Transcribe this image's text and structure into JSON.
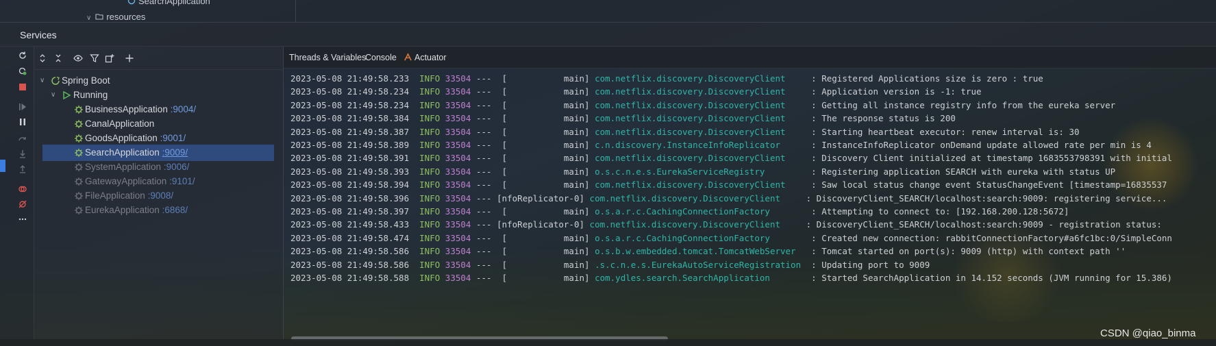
{
  "top": {
    "line1": "SearchApplication",
    "line2": "resources"
  },
  "services": {
    "title": "Services"
  },
  "tree": {
    "root": "Spring Boot",
    "group": "Running",
    "apps": [
      {
        "name": "BusinessApplication",
        "port": ":9004/",
        "running": true
      },
      {
        "name": "CanalApplication",
        "port": "",
        "running": true
      },
      {
        "name": "GoodsApplication",
        "port": ":9001/",
        "running": true
      },
      {
        "name": "SearchApplication",
        "port": ":9009/",
        "running": true,
        "selected": true
      },
      {
        "name": "SystemApplication",
        "port": ":9006/",
        "running": false
      },
      {
        "name": "GatewayApplication",
        "port": ":9101/",
        "running": false
      },
      {
        "name": "FileApplication",
        "port": ":9008/",
        "running": false
      },
      {
        "name": "EurekaApplication",
        "port": ":6868/",
        "running": false
      }
    ]
  },
  "console": {
    "tabs": [
      "Threads & Variables",
      "Console",
      "Actuator"
    ],
    "rows": [
      {
        "ts": "2023-05-08 21:49:58.233",
        "lvl": "INFO",
        "pid": "33504",
        "thread": "---  [           main]",
        "logger": "com.netflix.discovery.DiscoveryClient    ",
        "msg": " : Registered Applications size is zero : true"
      },
      {
        "ts": "2023-05-08 21:49:58.234",
        "lvl": "INFO",
        "pid": "33504",
        "thread": "---  [           main]",
        "logger": "com.netflix.discovery.DiscoveryClient    ",
        "msg": " : Application version is -1: true"
      },
      {
        "ts": "2023-05-08 21:49:58.234",
        "lvl": "INFO",
        "pid": "33504",
        "thread": "---  [           main]",
        "logger": "com.netflix.discovery.DiscoveryClient    ",
        "msg": " : Getting all instance registry info from the eureka server"
      },
      {
        "ts": "2023-05-08 21:49:58.384",
        "lvl": "INFO",
        "pid": "33504",
        "thread": "---  [           main]",
        "logger": "com.netflix.discovery.DiscoveryClient    ",
        "msg": " : The response status is 200"
      },
      {
        "ts": "2023-05-08 21:49:58.387",
        "lvl": "INFO",
        "pid": "33504",
        "thread": "---  [           main]",
        "logger": "com.netflix.discovery.DiscoveryClient    ",
        "msg": " : Starting heartbeat executor: renew interval is: 30"
      },
      {
        "ts": "2023-05-08 21:49:58.389",
        "lvl": "INFO",
        "pid": "33504",
        "thread": "---  [           main]",
        "logger": "c.n.discovery.InstanceInfoReplicator     ",
        "msg": " : InstanceInfoReplicator onDemand update allowed rate per min is 4"
      },
      {
        "ts": "2023-05-08 21:49:58.391",
        "lvl": "INFO",
        "pid": "33504",
        "thread": "---  [           main]",
        "logger": "com.netflix.discovery.DiscoveryClient    ",
        "msg": " : Discovery Client initialized at timestamp 1683553798391 with initial"
      },
      {
        "ts": "2023-05-08 21:49:58.393",
        "lvl": "INFO",
        "pid": "33504",
        "thread": "---  [           main]",
        "logger": "o.s.c.n.e.s.EurekaServiceRegistry        ",
        "msg": " : Registering application SEARCH with eureka with status UP"
      },
      {
        "ts": "2023-05-08 21:49:58.394",
        "lvl": "INFO",
        "pid": "33504",
        "thread": "---  [           main]",
        "logger": "com.netflix.discovery.DiscoveryClient    ",
        "msg": " : Saw local status change event StatusChangeEvent [timestamp=16835537"
      },
      {
        "ts": "2023-05-08 21:49:58.396",
        "lvl": "INFO",
        "pid": "33504",
        "thread": "--- [nfoReplicator-0]",
        "logger": "com.netflix.discovery.DiscoveryClient    ",
        "msg": " : DiscoveryClient_SEARCH/localhost:search:9009: registering service..."
      },
      {
        "ts": "2023-05-08 21:49:58.397",
        "lvl": "INFO",
        "pid": "33504",
        "thread": "---  [           main]",
        "logger": "o.s.a.r.c.CachingConnectionFactory       ",
        "msg": " : Attempting to connect to: [192.168.200.128:5672]"
      },
      {
        "ts": "2023-05-08 21:49:58.433",
        "lvl": "INFO",
        "pid": "33504",
        "thread": "--- [nfoReplicator-0]",
        "logger": "com.netflix.discovery.DiscoveryClient    ",
        "msg": " : DiscoveryClient_SEARCH/localhost:search:9009 - registration status: "
      },
      {
        "ts": "2023-05-08 21:49:58.474",
        "lvl": "INFO",
        "pid": "33504",
        "thread": "---  [           main]",
        "logger": "o.s.a.r.c.CachingConnectionFactory       ",
        "msg": " : Created new connection: rabbitConnectionFactory#a6fc1bc:0/SimpleConn"
      },
      {
        "ts": "2023-05-08 21:49:58.586",
        "lvl": "INFO",
        "pid": "33504",
        "thread": "---  [           main]",
        "logger": "o.s.b.w.embedded.tomcat.TomcatWebServer  ",
        "msg": " : Tomcat started on port(s): 9009 (http) with context path ''"
      },
      {
        "ts": "2023-05-08 21:49:58.586",
        "lvl": "INFO",
        "pid": "33504",
        "thread": "---  [           main]",
        "logger": ".s.c.n.e.s.EurekaAutoServiceRegistration ",
        "msg": " : Updating port to 9009"
      },
      {
        "ts": "2023-05-08 21:49:58.588",
        "lvl": "INFO",
        "pid": "33504",
        "thread": "---  [           main]",
        "logger": "com.ydles.search.SearchApplication       ",
        "msg": " : Started SearchApplication in 14.152 seconds (JVM running for 15.386)"
      }
    ]
  },
  "watermark": "CSDN @qiao_binma",
  "colors": {
    "selected": "#2f4a7c",
    "port": "#6f9be0",
    "logger": "#2fb5a8",
    "level": "#8fbf5f",
    "pid": "#c07fd0"
  }
}
